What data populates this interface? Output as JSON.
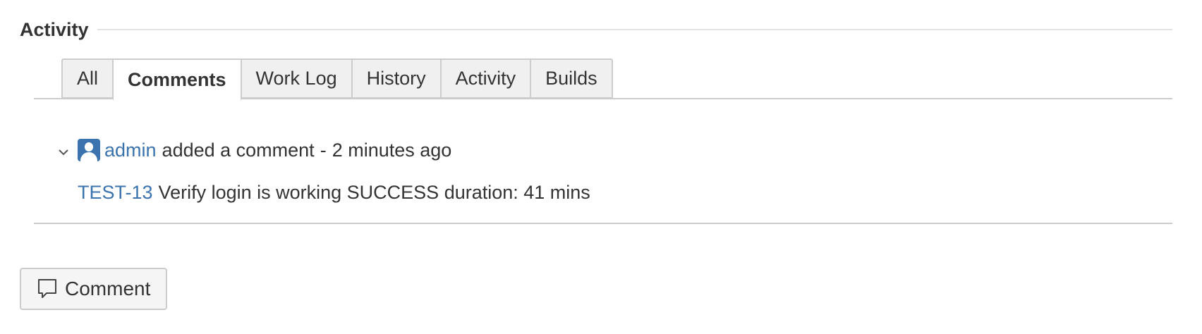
{
  "section": {
    "title": "Activity"
  },
  "tabs": [
    {
      "label": "All",
      "active": false
    },
    {
      "label": "Comments",
      "active": true
    },
    {
      "label": "Work Log",
      "active": false
    },
    {
      "label": "History",
      "active": false
    },
    {
      "label": "Activity",
      "active": false
    },
    {
      "label": "Builds",
      "active": false
    }
  ],
  "comment": {
    "author": "admin",
    "action": "added a comment",
    "separator": "-",
    "time": "2 minutes ago",
    "issue_key": "TEST-13",
    "text": "Verify login is working SUCCESS duration: 41 mins",
    "avatar_icon": "user-avatar-icon",
    "toggle_icon": "chevron-down-icon"
  },
  "actions": {
    "comment_button_label": "Comment",
    "comment_icon": "speech-bubble-icon"
  },
  "colors": {
    "link": "#3b73af",
    "text": "#333333",
    "tab_inactive_bg": "#f0f0f0",
    "border": "#cccccc"
  }
}
